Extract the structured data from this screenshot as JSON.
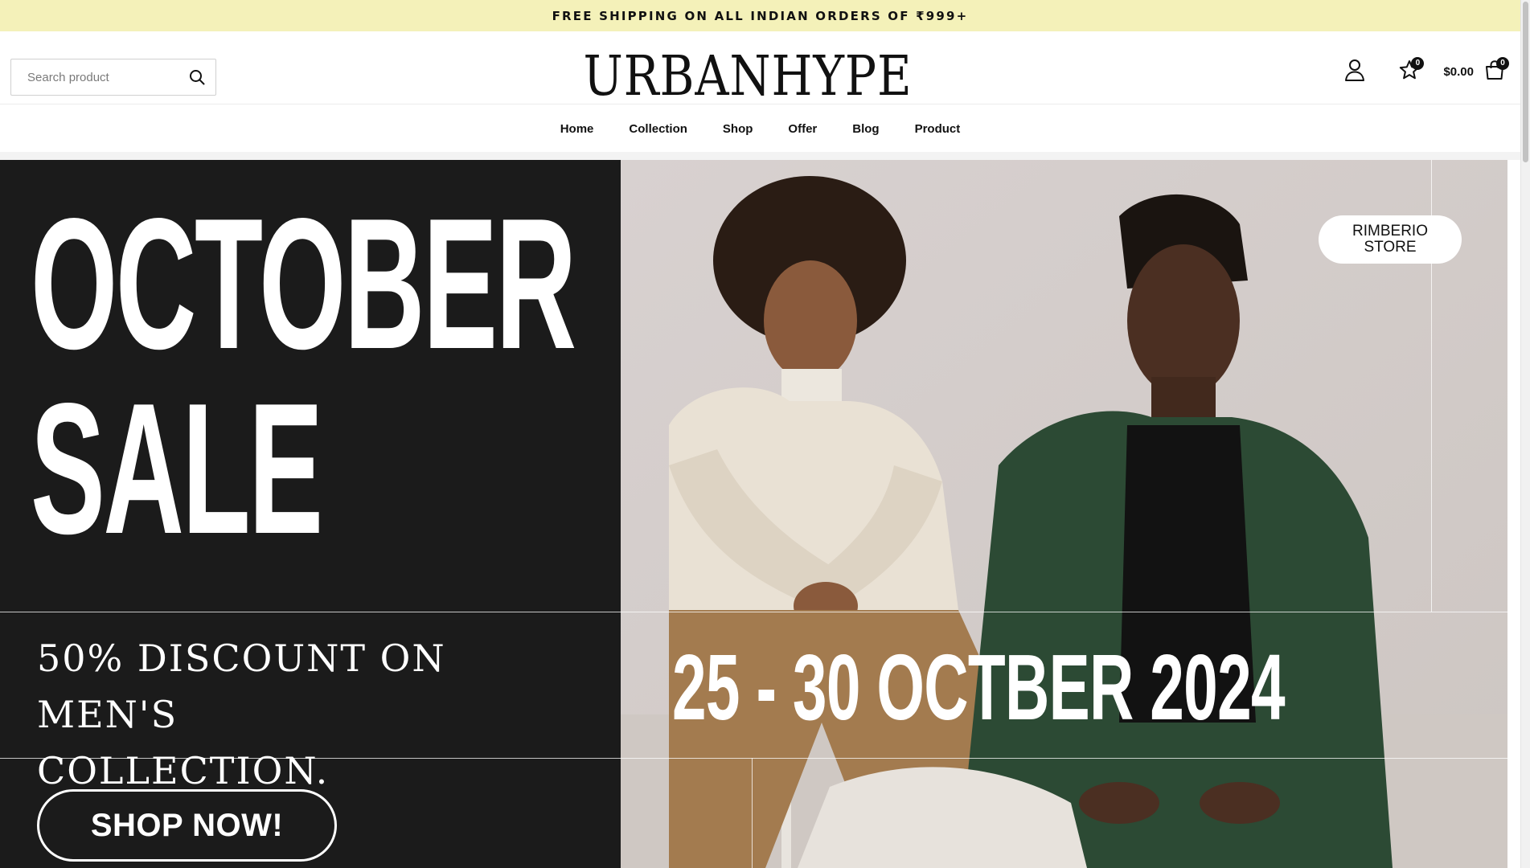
{
  "announcement": {
    "text": "FREE SHIPPING ON ALL INDIAN ORDERS OF ₹999+"
  },
  "header": {
    "search": {
      "placeholder": "Search product",
      "icon": "search-icon"
    },
    "logo": "URBANHYPE",
    "account_icon": "user-icon",
    "wishlist": {
      "icon": "star-icon",
      "count": "0"
    },
    "cart": {
      "total": "$0.00",
      "icon": "shopping-bag-icon",
      "count": "0"
    }
  },
  "nav": {
    "items": [
      {
        "label": "Home"
      },
      {
        "label": "Collection"
      },
      {
        "label": "Shop"
      },
      {
        "label": "Offer"
      },
      {
        "label": "Blog"
      },
      {
        "label": "Product"
      }
    ]
  },
  "hero": {
    "headline_line1": "OCTOBER",
    "headline_line2": "SALE",
    "discount_line1": "50% DISCOUNT ON MEN'S",
    "discount_line2": "COLLECTION.",
    "dates": "25 - 30 OCTBER 2024",
    "cta_label": "SHOP NOW!",
    "store_badge_line1": "RIMBERIO",
    "store_badge_line2": "STORE"
  },
  "colors": {
    "announcement_bg": "#f4f1b9",
    "hero_dark": "#1b1b1b",
    "photo_bg": "#d7d0cf",
    "green_shirt": "#2c4a34",
    "tan_pants": "#a37b4f",
    "cream_shirt": "#e9e1d4"
  }
}
